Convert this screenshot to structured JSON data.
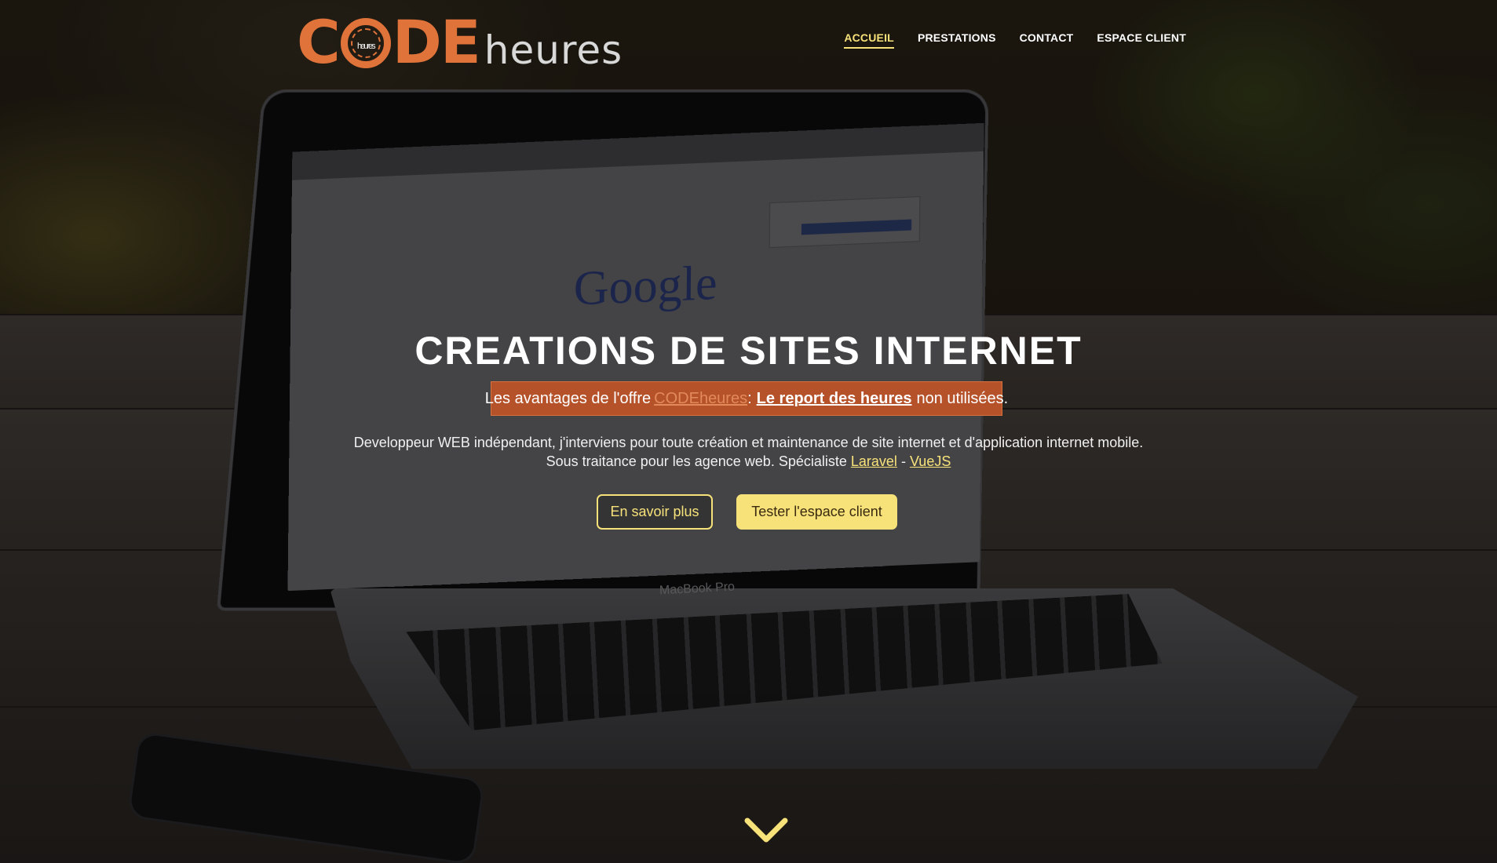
{
  "header": {
    "logo": {
      "code_text_part1": "C",
      "code_text_part2": "DE",
      "clock_label": "heures",
      "suffix": "heures"
    },
    "nav": [
      {
        "label": "ACCUEIL",
        "active": true
      },
      {
        "label": "PRESTATIONS",
        "active": false
      },
      {
        "label": "CONTACT",
        "active": false
      },
      {
        "label": "ESPACE CLIENT",
        "active": false
      }
    ]
  },
  "hero": {
    "title": "CREATIONS DE SITES INTERNET",
    "promo": {
      "prefix": "Les avantages de l'offre",
      "brand": "CODEheures",
      "colon": ":",
      "highlight": "Le report des heures",
      "suffix": "non utilisées."
    },
    "description": {
      "line1": "Developpeur WEB indépendant, j'interviens pour toute création et maintenance de site internet et d'application internet mobile.",
      "line2_prefix": "Sous traitance pour les agence web. Spécialiste",
      "link1": "Laravel",
      "separator": "-",
      "link2": "VueJS"
    },
    "buttons": {
      "learn_more": "En savoir plus",
      "try_client": "Tester l'espace client"
    }
  },
  "background_photo": {
    "search_brand": "Google",
    "laptop_label": "MacBook Pro"
  },
  "scroll_hint": {
    "icon": "chevron-down-icon"
  },
  "colors": {
    "brand_orange": "#e0733a",
    "accent_yellow": "#f7e27a",
    "promo_bg": "#b5522a"
  }
}
